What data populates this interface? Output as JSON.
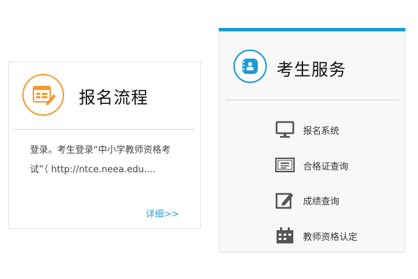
{
  "registration_process": {
    "title": "报名流程",
    "description": "登录。考生登录“中小学教师资格考试”（ http://ntce.neea.edu....",
    "more_link": "详细>>",
    "accent_color": "#f39a2d",
    "icon": "form-edit-icon"
  },
  "candidate_services": {
    "title": "考生服务",
    "accent_color": "#1a9ad8",
    "icon": "notebook-icon",
    "items": [
      {
        "label": "报名系统",
        "icon": "monitor-icon"
      },
      {
        "label": "合格证查询",
        "icon": "certificate-icon"
      },
      {
        "label": "成绩查询",
        "icon": "edit-pencil-icon"
      },
      {
        "label": "教师资格认定",
        "icon": "calendar-icon"
      }
    ]
  }
}
